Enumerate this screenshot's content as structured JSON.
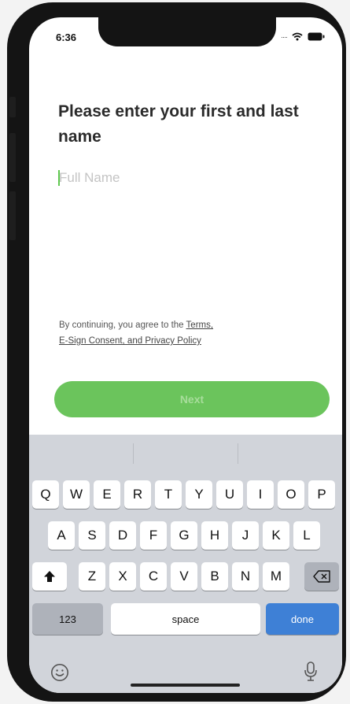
{
  "status": {
    "time": "6:36",
    "signal_dots": "····"
  },
  "title": "Please enter your first and last name",
  "input": {
    "placeholder": "Full Name",
    "value": ""
  },
  "legal": {
    "prefix": "By continuing, you agree to the ",
    "terms_link": "Terms,",
    "consent_link": "E-Sign Consent, and Privacy Policy"
  },
  "next_button": {
    "label": "Next"
  },
  "keyboard": {
    "row1": [
      "Q",
      "W",
      "E",
      "R",
      "T",
      "Y",
      "U",
      "I",
      "O",
      "P"
    ],
    "row2": [
      "A",
      "S",
      "D",
      "F",
      "G",
      "H",
      "J",
      "K",
      "L"
    ],
    "row3": [
      "Z",
      "X",
      "C",
      "V",
      "B",
      "N",
      "M"
    ],
    "numbers_label": "123",
    "space_label": "space",
    "done_label": "done"
  },
  "icons": [
    "wifi-icon",
    "battery-icon",
    "shift-icon",
    "backspace-icon",
    "emoji-icon",
    "microphone-icon"
  ],
  "colors": {
    "accent_green": "#6bc45c",
    "done_blue": "#3e80d6",
    "keyboard_bg": "#d1d4da"
  }
}
